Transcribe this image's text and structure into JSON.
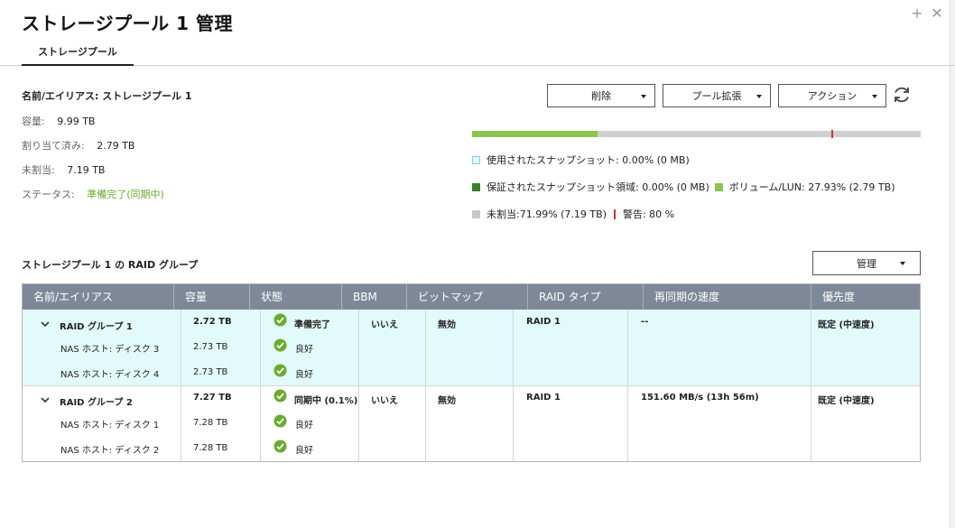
{
  "window": {
    "title": "ストレージプール 1 管理",
    "add_glyph": "+",
    "close_glyph": "✕"
  },
  "tabs": [
    {
      "label": "ストレージプール"
    }
  ],
  "pool": {
    "name": "名前/エイリアス: ストレージプール 1",
    "capacity_label": "容量:",
    "capacity": "9.99 TB",
    "allocated_label": "割り当て済み:",
    "allocated": "2.79 TB",
    "unallocated_label": "未割当:",
    "unallocated": "7.19 TB",
    "status_label": "ステータス:",
    "status": "準備完了(同期中)"
  },
  "actions": {
    "delete": "削除",
    "expand": "プール拡張",
    "action": "アクション"
  },
  "usage": {
    "volume_fraction": 0.2793,
    "warning_threshold": 0.8,
    "colors": {
      "volume": "#8cc44f",
      "unallocated": "#cfcfcf",
      "warning": "#d0312d",
      "guaranteed": "#3a7d2a",
      "snapshot": "#e8fbfd"
    },
    "legend": {
      "snapshot_used": "使用されたスナップショット: 0.00% (0 MB)",
      "snapshot_guaranteed": "保証されたスナップショット領域: 0.00% (0 MB)",
      "volume_lun": "ボリューム/LUN: 27.93% (2.79 TB)",
      "unallocated": "未割当:71.99% (7.19 TB)",
      "warning": "警告: 80 %"
    }
  },
  "raid": {
    "section_title": "ストレージプール 1 の RAID グループ",
    "manage": "管理",
    "columns": [
      "名前/エイリアス",
      "容量",
      "状態",
      "BBM",
      "ビットマップ",
      "RAID タイプ",
      "再同期の速度",
      "優先度"
    ],
    "groups": [
      {
        "name": "RAID グループ 1",
        "capacity": "2.72 TB",
        "status": "準備完了",
        "bbm": "いいえ",
        "bitmap": "無効",
        "raid_type": "RAID 1",
        "resync_speed": "--",
        "priority": "既定 (中速度)",
        "disks": [
          {
            "name": "NAS ホスト: ディスク 3",
            "capacity": "2.73 TB",
            "status": "良好"
          },
          {
            "name": "NAS ホスト: ディスク 4",
            "capacity": "2.73 TB",
            "status": "良好"
          }
        ]
      },
      {
        "name": "RAID グループ 2",
        "capacity": "7.27 TB",
        "status": "同期中 (0.1%)",
        "bbm": "いいえ",
        "bitmap": "無効",
        "raid_type": "RAID 1",
        "resync_speed": "151.60 MB/s (13h 56m)",
        "priority": "既定 (中速度)",
        "disks": [
          {
            "name": "NAS ホスト: ディスク 1",
            "capacity": "7.28 TB",
            "status": "良好"
          },
          {
            "name": "NAS ホスト: ディスク 2",
            "capacity": "7.28 TB",
            "status": "良好"
          }
        ]
      }
    ]
  }
}
